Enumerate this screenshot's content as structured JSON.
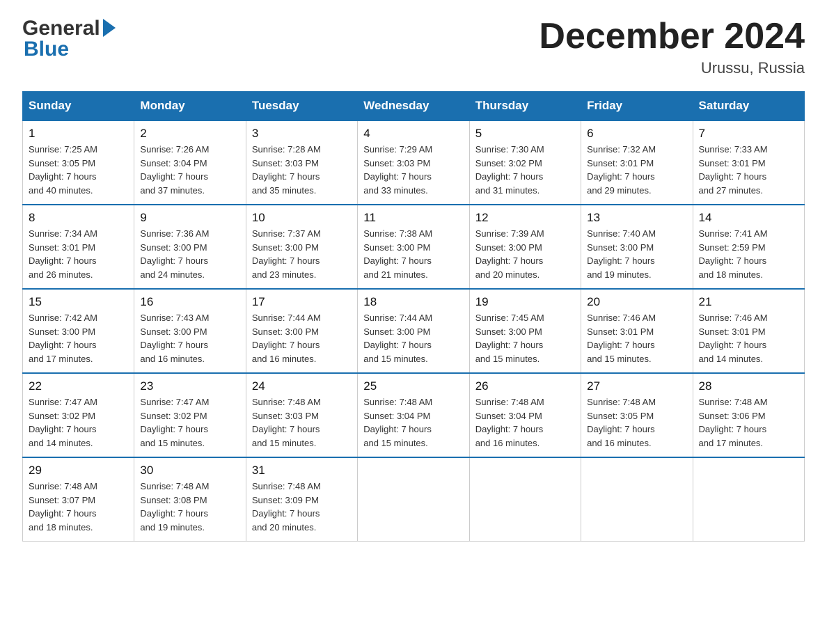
{
  "header": {
    "logo": {
      "general": "General",
      "blue": "Blue"
    },
    "month_title": "December 2024",
    "location": "Urussu, Russia"
  },
  "days_of_week": [
    "Sunday",
    "Monday",
    "Tuesday",
    "Wednesday",
    "Thursday",
    "Friday",
    "Saturday"
  ],
  "weeks": [
    [
      {
        "day": "1",
        "sunrise": "7:25 AM",
        "sunset": "3:05 PM",
        "daylight": "7 hours and 40 minutes."
      },
      {
        "day": "2",
        "sunrise": "7:26 AM",
        "sunset": "3:04 PM",
        "daylight": "7 hours and 37 minutes."
      },
      {
        "day": "3",
        "sunrise": "7:28 AM",
        "sunset": "3:03 PM",
        "daylight": "7 hours and 35 minutes."
      },
      {
        "day": "4",
        "sunrise": "7:29 AM",
        "sunset": "3:03 PM",
        "daylight": "7 hours and 33 minutes."
      },
      {
        "day": "5",
        "sunrise": "7:30 AM",
        "sunset": "3:02 PM",
        "daylight": "7 hours and 31 minutes."
      },
      {
        "day": "6",
        "sunrise": "7:32 AM",
        "sunset": "3:01 PM",
        "daylight": "7 hours and 29 minutes."
      },
      {
        "day": "7",
        "sunrise": "7:33 AM",
        "sunset": "3:01 PM",
        "daylight": "7 hours and 27 minutes."
      }
    ],
    [
      {
        "day": "8",
        "sunrise": "7:34 AM",
        "sunset": "3:01 PM",
        "daylight": "7 hours and 26 minutes."
      },
      {
        "day": "9",
        "sunrise": "7:36 AM",
        "sunset": "3:00 PM",
        "daylight": "7 hours and 24 minutes."
      },
      {
        "day": "10",
        "sunrise": "7:37 AM",
        "sunset": "3:00 PM",
        "daylight": "7 hours and 23 minutes."
      },
      {
        "day": "11",
        "sunrise": "7:38 AM",
        "sunset": "3:00 PM",
        "daylight": "7 hours and 21 minutes."
      },
      {
        "day": "12",
        "sunrise": "7:39 AM",
        "sunset": "3:00 PM",
        "daylight": "7 hours and 20 minutes."
      },
      {
        "day": "13",
        "sunrise": "7:40 AM",
        "sunset": "3:00 PM",
        "daylight": "7 hours and 19 minutes."
      },
      {
        "day": "14",
        "sunrise": "7:41 AM",
        "sunset": "2:59 PM",
        "daylight": "7 hours and 18 minutes."
      }
    ],
    [
      {
        "day": "15",
        "sunrise": "7:42 AM",
        "sunset": "3:00 PM",
        "daylight": "7 hours and 17 minutes."
      },
      {
        "day": "16",
        "sunrise": "7:43 AM",
        "sunset": "3:00 PM",
        "daylight": "7 hours and 16 minutes."
      },
      {
        "day": "17",
        "sunrise": "7:44 AM",
        "sunset": "3:00 PM",
        "daylight": "7 hours and 16 minutes."
      },
      {
        "day": "18",
        "sunrise": "7:44 AM",
        "sunset": "3:00 PM",
        "daylight": "7 hours and 15 minutes."
      },
      {
        "day": "19",
        "sunrise": "7:45 AM",
        "sunset": "3:00 PM",
        "daylight": "7 hours and 15 minutes."
      },
      {
        "day": "20",
        "sunrise": "7:46 AM",
        "sunset": "3:01 PM",
        "daylight": "7 hours and 15 minutes."
      },
      {
        "day": "21",
        "sunrise": "7:46 AM",
        "sunset": "3:01 PM",
        "daylight": "7 hours and 14 minutes."
      }
    ],
    [
      {
        "day": "22",
        "sunrise": "7:47 AM",
        "sunset": "3:02 PM",
        "daylight": "7 hours and 14 minutes."
      },
      {
        "day": "23",
        "sunrise": "7:47 AM",
        "sunset": "3:02 PM",
        "daylight": "7 hours and 15 minutes."
      },
      {
        "day": "24",
        "sunrise": "7:48 AM",
        "sunset": "3:03 PM",
        "daylight": "7 hours and 15 minutes."
      },
      {
        "day": "25",
        "sunrise": "7:48 AM",
        "sunset": "3:04 PM",
        "daylight": "7 hours and 15 minutes."
      },
      {
        "day": "26",
        "sunrise": "7:48 AM",
        "sunset": "3:04 PM",
        "daylight": "7 hours and 16 minutes."
      },
      {
        "day": "27",
        "sunrise": "7:48 AM",
        "sunset": "3:05 PM",
        "daylight": "7 hours and 16 minutes."
      },
      {
        "day": "28",
        "sunrise": "7:48 AM",
        "sunset": "3:06 PM",
        "daylight": "7 hours and 17 minutes."
      }
    ],
    [
      {
        "day": "29",
        "sunrise": "7:48 AM",
        "sunset": "3:07 PM",
        "daylight": "7 hours and 18 minutes."
      },
      {
        "day": "30",
        "sunrise": "7:48 AM",
        "sunset": "3:08 PM",
        "daylight": "7 hours and 19 minutes."
      },
      {
        "day": "31",
        "sunrise": "7:48 AM",
        "sunset": "3:09 PM",
        "daylight": "7 hours and 20 minutes."
      },
      null,
      null,
      null,
      null
    ]
  ],
  "labels": {
    "sunrise_prefix": "Sunrise: ",
    "sunset_prefix": "Sunset: ",
    "daylight_prefix": "Daylight: "
  }
}
